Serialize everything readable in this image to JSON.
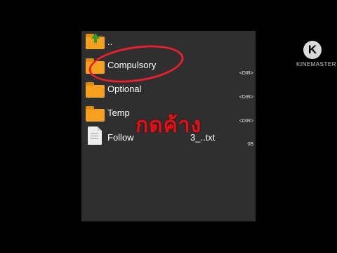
{
  "colors": {
    "background": "#000000",
    "panel": "#2f2f2f",
    "folder": "#f5a11f",
    "annotation": "#e41018"
  },
  "file_list": {
    "items": [
      {
        "name": "..",
        "type": "parent-folder",
        "icon": "folder-up-icon",
        "meta": ""
      },
      {
        "name": "Compulsory",
        "type": "folder",
        "icon": "folder-icon",
        "meta": "<DIR>"
      },
      {
        "name": "Optional",
        "type": "folder",
        "icon": "folder-icon",
        "meta": "<DIR>"
      },
      {
        "name": "Temp",
        "type": "folder",
        "icon": "folder-icon",
        "meta": "<DIR>"
      },
      {
        "name": "Follow",
        "name_suffix": "3_..txt",
        "type": "file",
        "icon": "text-file-icon",
        "meta": "0B"
      }
    ]
  },
  "annotation": {
    "text": "กดค้าง",
    "highlighted_item": "Compulsory"
  },
  "watermark": {
    "logo_letter": "K",
    "text": "KINEMASTER"
  }
}
